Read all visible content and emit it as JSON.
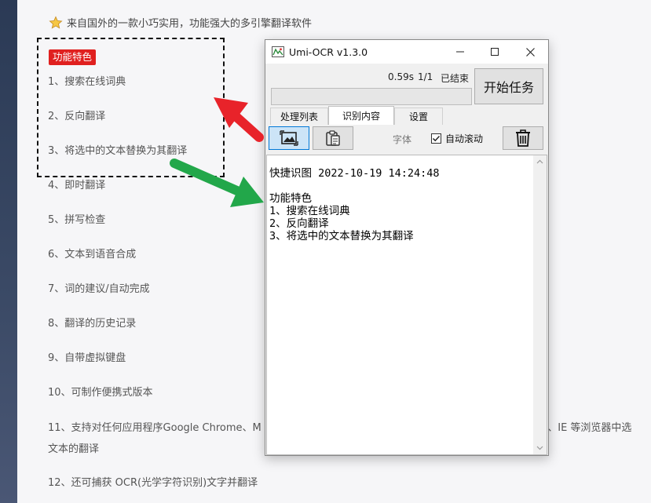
{
  "article": {
    "intro": "来自国外的一款小巧实用，功能强大的多引擎翻译软件",
    "badge": "功能特色",
    "items": [
      "1、搜索在线词典",
      "2、反向翻译",
      "3、将选中的文本替换为其翻译",
      "4、即时翻译",
      "5、拼写检查",
      "6、文本到语音合成",
      "7、词的建议/自动完成",
      "8、翻译的历史记录",
      "9、自带虚拟键盘",
      "10、可制作便携式版本",
      "11、支持对任何应用程序Google Chrome、M",
      "be、IE 等浏览器中选",
      "文本的翻译",
      "12、还可捕获 OCR(光学字符识别)文字并翻译"
    ]
  },
  "window": {
    "title": "Umi-OCR v1.3.0",
    "time": "0.59s",
    "count": "1/1",
    "status": "已结束",
    "start_button": "开始任务",
    "progress_percent": 0,
    "tabs": [
      "处理列表",
      "识别内容",
      "设置"
    ],
    "active_tab": "识别内容",
    "font_label": "字体",
    "autoscroll_label": "自动滚动",
    "autoscroll_checked": true,
    "output_lines": [
      "快捷识图 2022-10-19 14:24:48",
      "",
      "功能特色",
      "1、搜索在线词典",
      "2、反向翻译",
      "3、将选中的文本替换为其翻译"
    ]
  },
  "colors": {
    "badge": "#e0201f",
    "arrow_red": "#e8232a",
    "arrow_green": "#22a74a",
    "tool_active": "#cce4f7"
  },
  "icons": [
    "star-icon",
    "app-icon",
    "minimize-icon",
    "maximize-icon",
    "close-icon",
    "screenshot-icon",
    "clipboard-icon",
    "trash-icon",
    "check-icon"
  ]
}
